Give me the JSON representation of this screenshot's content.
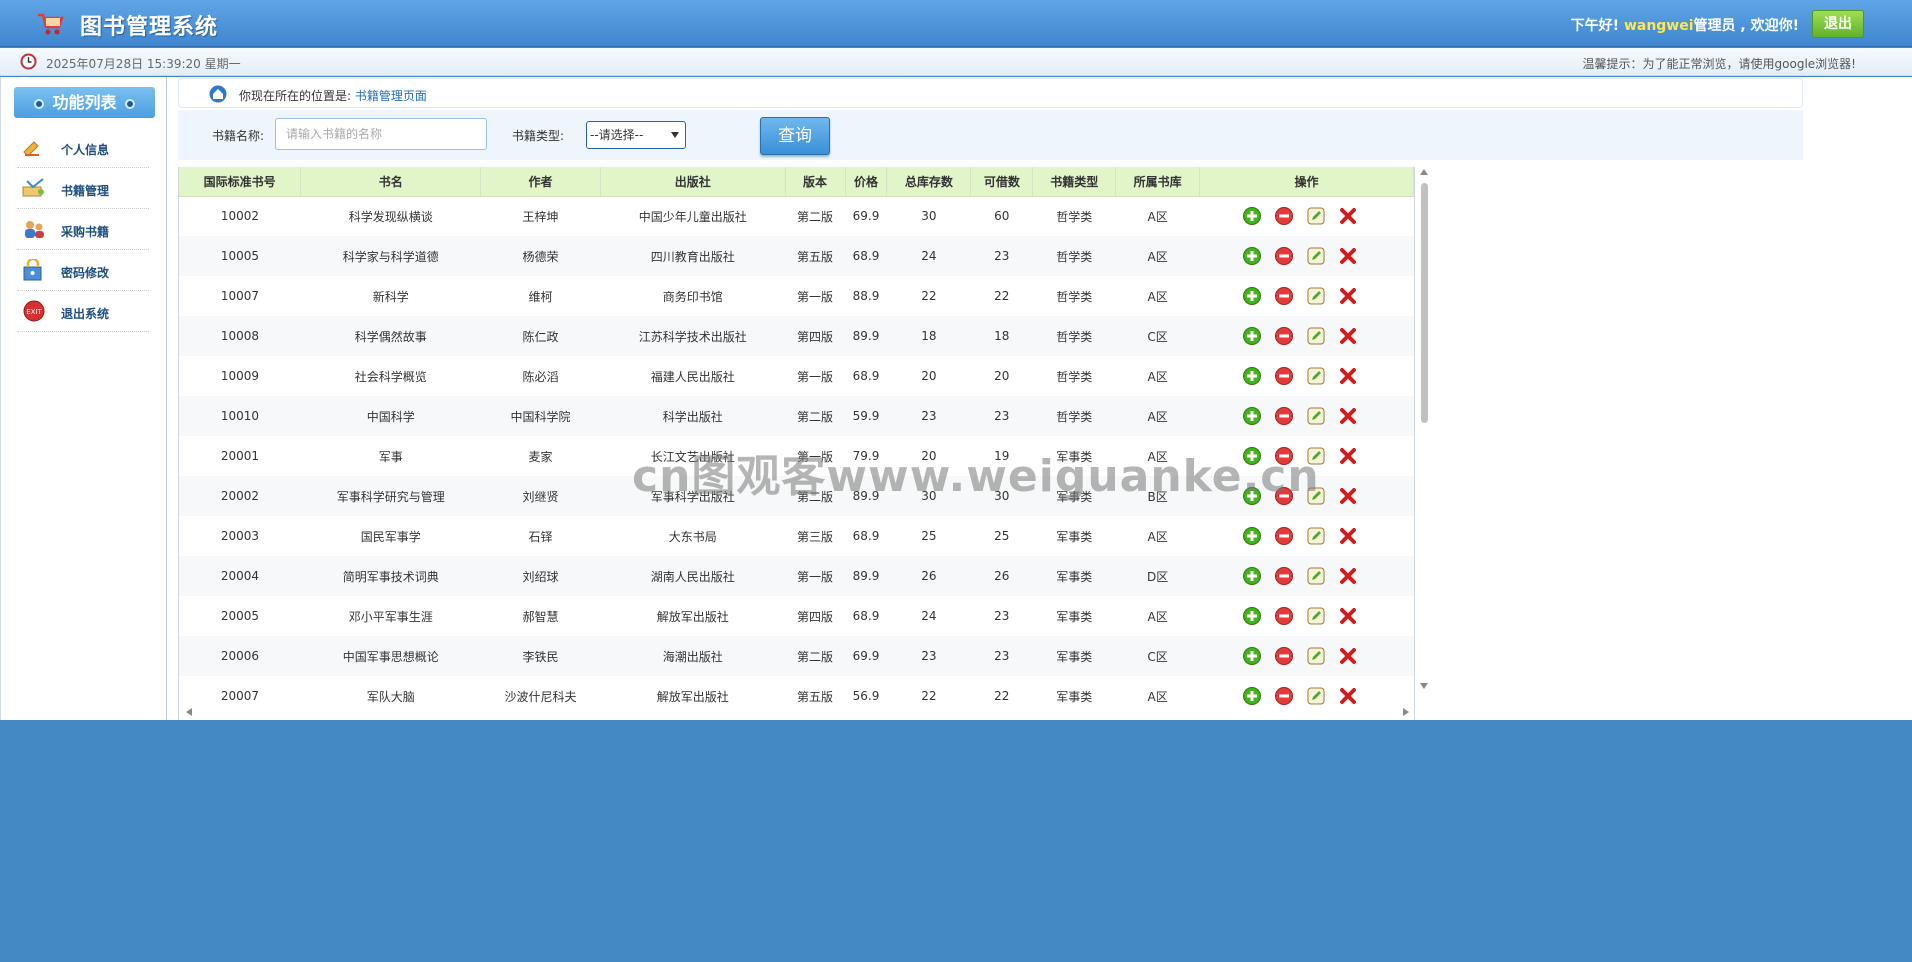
{
  "header": {
    "title": "图书管理系统",
    "greeting_prefix": "下午好!",
    "username": "wangwei",
    "greeting_suffix": "管理员 , 欢迎你!",
    "logout_label": "退出"
  },
  "subbar": {
    "datetime": "2025年07月28日 15:39:20 星期一",
    "tip": "温馨提示：为了能正常浏览，请使用google浏览器!"
  },
  "sidebar": {
    "title": "功能列表",
    "items": [
      {
        "label": "个人信息",
        "icon": "user-info-icon"
      },
      {
        "label": "书籍管理",
        "icon": "book-manage-icon"
      },
      {
        "label": "采购书籍",
        "icon": "purchase-icon"
      },
      {
        "label": "密码修改",
        "icon": "password-icon"
      },
      {
        "label": "退出系统",
        "icon": "exit-icon"
      }
    ]
  },
  "breadcrumb": {
    "prefix": "你现在所在的位置是:",
    "current": "书籍管理页面"
  },
  "search": {
    "name_label": "书籍名称:",
    "name_placeholder": "请输入书籍的名称",
    "type_label": "书籍类型:",
    "type_selected": "--请选择--",
    "query_label": "查询"
  },
  "table": {
    "headers": [
      "国际标准书号",
      "书名",
      "作者",
      "出版社",
      "版本",
      "价格",
      "总库存数",
      "可借数",
      "书籍类型",
      "所属书库",
      "操作"
    ],
    "rows": [
      [
        "10002",
        "科学发现纵横谈",
        "王梓坤",
        "中国少年儿童出版社",
        "第二版",
        "69.9",
        "30",
        "60",
        "哲学类",
        "A区"
      ],
      [
        "10005",
        "科学家与科学道德",
        "杨德荣",
        "四川教育出版社",
        "第五版",
        "68.9",
        "24",
        "23",
        "哲学类",
        "A区"
      ],
      [
        "10007",
        "新科学",
        "维柯",
        "商务印书馆",
        "第一版",
        "88.9",
        "22",
        "22",
        "哲学类",
        "A区"
      ],
      [
        "10008",
        "科学偶然故事",
        "陈仁政",
        "江苏科学技术出版社",
        "第四版",
        "89.9",
        "18",
        "18",
        "哲学类",
        "C区"
      ],
      [
        "10009",
        "社会科学概览",
        "陈必滔",
        "福建人民出版社",
        "第一版",
        "68.9",
        "20",
        "20",
        "哲学类",
        "A区"
      ],
      [
        "10010",
        "中国科学",
        "中国科学院",
        "科学出版社",
        "第二版",
        "59.9",
        "23",
        "23",
        "哲学类",
        "A区"
      ],
      [
        "20001",
        "军事",
        "麦家",
        "长江文艺出版社",
        "第一版",
        "79.9",
        "20",
        "19",
        "军事类",
        "A区"
      ],
      [
        "20002",
        "军事科学研究与管理",
        "刘继贤",
        "军事科学出版社",
        "第二版",
        "89.9",
        "30",
        "30",
        "军事类",
        "B区"
      ],
      [
        "20003",
        "国民军事学",
        "石铎",
        "大东书局",
        "第三版",
        "68.9",
        "25",
        "25",
        "军事类",
        "A区"
      ],
      [
        "20004",
        "简明军事技术词典",
        "刘绍球",
        "湖南人民出版社",
        "第一版",
        "89.9",
        "26",
        "26",
        "军事类",
        "D区"
      ],
      [
        "20005",
        "邓小平军事生涯",
        "郝智慧",
        "解放军出版社",
        "第四版",
        "68.9",
        "24",
        "23",
        "军事类",
        "A区"
      ],
      [
        "20006",
        "中国军事思想概论",
        "李铁民",
        "海潮出版社",
        "第二版",
        "69.9",
        "23",
        "23",
        "军事类",
        "C区"
      ],
      [
        "20007",
        "军队大脑",
        "沙波什尼科夫",
        "解放军出版社",
        "第五版",
        "56.9",
        "22",
        "22",
        "军事类",
        "A区"
      ]
    ],
    "row_action_icons": [
      "add-icon",
      "minus-icon",
      "edit-icon",
      "delete-icon"
    ]
  },
  "watermark": "cn图观客www.weiguanke.cn",
  "colors": {
    "header_blue": "#4a92d8",
    "page_bg": "#4589c3",
    "table_header_bg": "#e2f5c9",
    "username_yellow": "#ffe84a",
    "logout_green": "#6ab934"
  }
}
